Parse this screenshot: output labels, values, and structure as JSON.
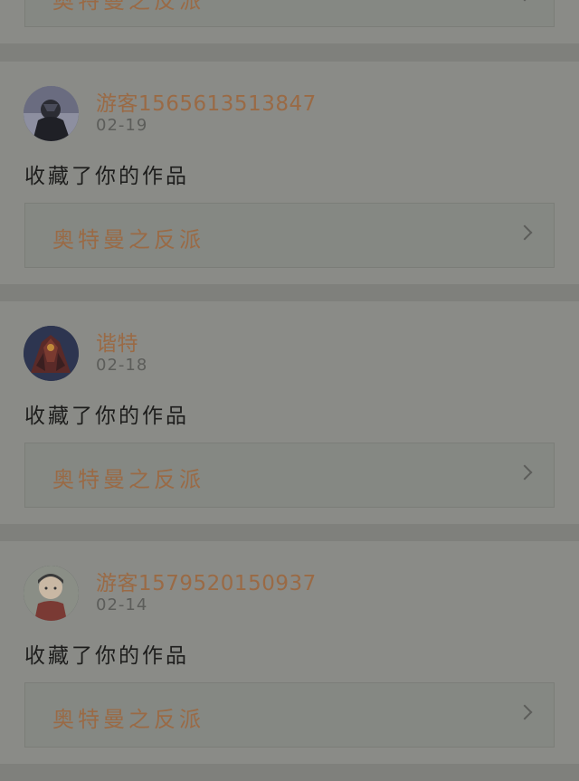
{
  "feed": {
    "partial_item": {
      "work_title": "奥特曼之反派"
    },
    "items": [
      {
        "username": "游客1565613513847",
        "date": "02-19",
        "action": "收藏了你的作品",
        "work_title": "奥特曼之反派"
      },
      {
        "username": "谐特",
        "date": "02-18",
        "action": "收藏了你的作品",
        "work_title": "奥特曼之反派"
      },
      {
        "username": "游客1579520150937",
        "date": "02-14",
        "action": "收藏了你的作品",
        "work_title": "奥特曼之反派"
      }
    ]
  },
  "icons": {
    "chevron": "chevron-right-icon",
    "avatar": "avatar"
  },
  "colors": {
    "accent": "#9a6a45",
    "background": "#7f807c",
    "card": "#8a8b87"
  }
}
